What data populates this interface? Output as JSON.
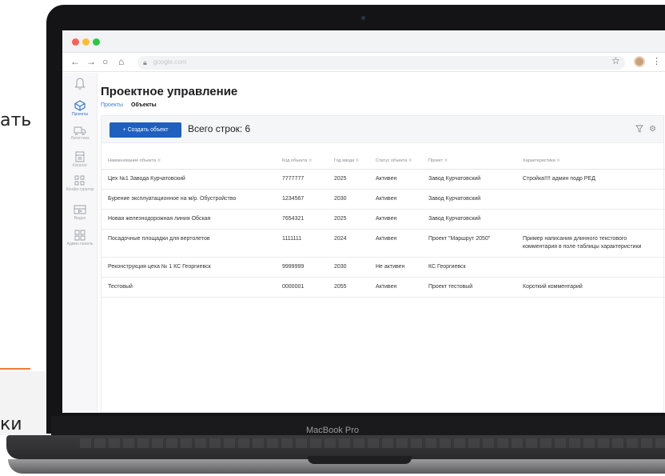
{
  "slide": {
    "cropped_text_top": "ать",
    "cropped_text_bottom": "ки"
  },
  "laptop": {
    "brand_label": "MacBook Pro"
  },
  "browser": {
    "url": "google.com"
  },
  "sidebar": {
    "items": [
      {
        "label": "",
        "icon": "bell-icon"
      },
      {
        "label": "Проекты",
        "icon": "projects-icon",
        "active": true
      },
      {
        "label": "Логистика",
        "icon": "logistics-icon"
      },
      {
        "label": "Каталог",
        "icon": "catalog-icon"
      },
      {
        "label": "Конфи-гуратор",
        "icon": "configurator-icon"
      },
      {
        "label": "Видео",
        "icon": "video-icon"
      },
      {
        "label": "Админ панель",
        "icon": "admin-panel-icon"
      }
    ]
  },
  "page": {
    "title": "Проектное управление",
    "tabs": [
      {
        "label": "Проекты",
        "active": false
      },
      {
        "label": "Объекты",
        "active": true
      }
    ]
  },
  "toolbar": {
    "add_button_label": "+ Создать объект",
    "total_label": "Всего строк: 6"
  },
  "table": {
    "headers": [
      "Наименование объекта",
      "Код объекта",
      "Год ввода",
      "Статус объекта",
      "Проект",
      "Характеристики"
    ],
    "rows": [
      [
        "Цех №1 Завода Курчатовский",
        "7777777",
        "2025",
        "Активен",
        "Завод Курчатовский",
        "Стройка!!!! админ подр РЕД"
      ],
      [
        "Бурение эксплуатационное на м/р. Обустройство",
        "1234567",
        "2030",
        "Активен",
        "Завод Курчатовский",
        ""
      ],
      [
        "Новая железнодорожная линия Обская",
        "7654321",
        "2025",
        "Активен",
        "Завод Курчатовский",
        ""
      ],
      [
        "Посадочные площадки для вертолетов",
        "1111111",
        "2024",
        "Активен",
        "Проект \"Маршрут 2050\"",
        "Пример написания длинного текстового комментария в поле таблицы характеристики"
      ],
      [
        "Реконструкция цеха № 1 КС Георгиевск",
        "9999999",
        "2030",
        "Не активен",
        "КС Георгиевск",
        ""
      ],
      [
        "Тестовый",
        "0000001",
        "2055",
        "Активен",
        "Проект тестовый",
        "Короткий комментарий"
      ]
    ]
  },
  "colors": {
    "accent": "#1f5fbf",
    "link": "#3b7ddd"
  }
}
